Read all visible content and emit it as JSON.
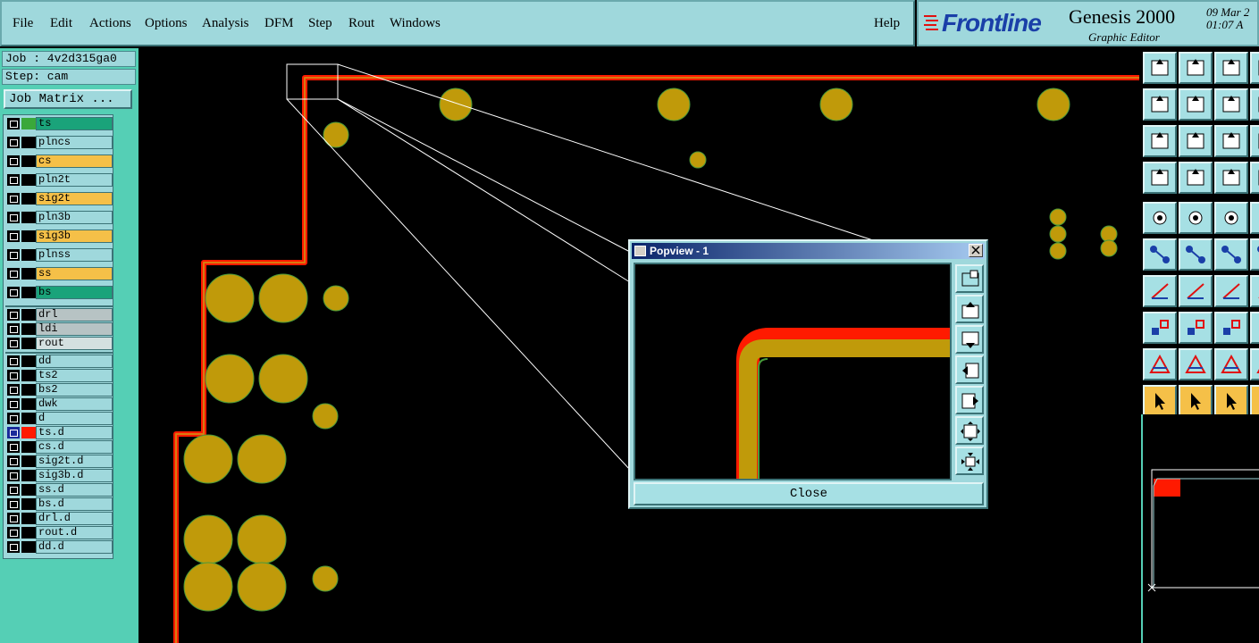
{
  "menu": {
    "file": "File",
    "edit": "Edit",
    "actions": "Actions",
    "options": "Options",
    "analysis": "Analysis",
    "dfm": "DFM",
    "step": "Step",
    "rout": "Rout",
    "windows": "Windows",
    "help": "Help"
  },
  "branding": {
    "logo": "Frontline",
    "app_name": "Genesis 2000",
    "subtitle": "Graphic Editor",
    "date": "09 Mar 2",
    "time": "01:07 A"
  },
  "job": {
    "job_label": "Job : 4v2d315ga0",
    "step_label": "Step: cam",
    "matrix_button": "Job Matrix ..."
  },
  "layers": [
    {
      "name": "ts",
      "color": "#1aa37a"
    },
    {
      "name": "plncs",
      "color": "#9fd8dc"
    },
    {
      "name": "cs",
      "color": "#f5c048"
    },
    {
      "name": "pln2t",
      "color": "#9fd8dc"
    },
    {
      "name": "sig2t",
      "color": "#f5c048"
    },
    {
      "name": "pln3b",
      "color": "#9fd8dc"
    },
    {
      "name": "sig3b",
      "color": "#f5c048"
    },
    {
      "name": "plnss",
      "color": "#9fd8dc"
    },
    {
      "name": "ss",
      "color": "#f5c048"
    },
    {
      "name": "bs",
      "color": "#1aa37a"
    },
    {
      "name": "drl",
      "color": "#b7c3c4"
    },
    {
      "name": "ldi",
      "color": "#b7c3c4"
    },
    {
      "name": "rout",
      "color": "#d4e0e0"
    },
    {
      "name": "dd",
      "color": "#9fd8dc"
    },
    {
      "name": "ts2",
      "color": "#9fd8dc"
    },
    {
      "name": "bs2",
      "color": "#9fd8dc"
    },
    {
      "name": "dwk",
      "color": "#9fd8dc"
    },
    {
      "name": "d",
      "color": "#9fd8dc"
    },
    {
      "name": "ts.d",
      "color": "#9fd8dc"
    },
    {
      "name": "cs.d",
      "color": "#9fd8dc"
    },
    {
      "name": "sig2t.d",
      "color": "#9fd8dc"
    },
    {
      "name": "sig3b.d",
      "color": "#9fd8dc"
    },
    {
      "name": "ss.d",
      "color": "#9fd8dc"
    },
    {
      "name": "bs.d",
      "color": "#9fd8dc"
    },
    {
      "name": "drl.d",
      "color": "#9fd8dc"
    },
    {
      "name": "rout.d",
      "color": "#9fd8dc"
    },
    {
      "name": "dd.d",
      "color": "#9fd8dc"
    }
  ],
  "popview": {
    "title": "Popview - 1",
    "close_button": "Close"
  },
  "colors": {
    "pad": "#c09a0a",
    "pad_outline": "#4a9a3a",
    "trace_outer": "#ff1a00",
    "trace_inner": "#d87a10",
    "panel": "#9fd8dc",
    "accent": "#55cfb5"
  }
}
